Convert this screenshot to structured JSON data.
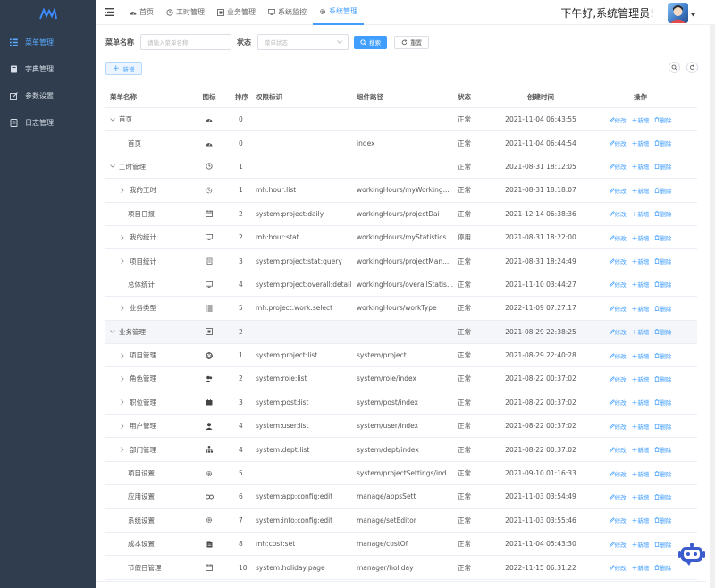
{
  "sidebar": {
    "logo_icon": "cat-logo-icon",
    "items": [
      {
        "label": "菜单管理",
        "icon": "menu-list-icon",
        "active": true
      },
      {
        "label": "字典管理",
        "icon": "book-icon",
        "active": false
      },
      {
        "label": "参数设置",
        "icon": "edit-icon",
        "active": false
      },
      {
        "label": "日志管理",
        "icon": "log-icon",
        "active": false,
        "has_children": true
      }
    ]
  },
  "header": {
    "tabs": [
      {
        "label": "首页",
        "icon": "dashboard-icon",
        "active": false
      },
      {
        "label": "工时管理",
        "icon": "clock-icon",
        "active": false
      },
      {
        "label": "业务管理",
        "icon": "business-icon",
        "active": false
      },
      {
        "label": "系统监控",
        "icon": "monitor-icon",
        "active": false
      },
      {
        "label": "系统管理",
        "icon": "gear-icon",
        "active": true
      }
    ],
    "greeting": "下午好,系统管理员!"
  },
  "search": {
    "menu_name_label": "菜单名称",
    "menu_name_placeholder": "请输入菜单名称",
    "status_label": "状态",
    "status_placeholder": "菜单状态",
    "search_button": "搜索",
    "reset_button": "重置"
  },
  "toolbar": {
    "add_button": "新增"
  },
  "table": {
    "columns": [
      "菜单名称",
      "图标",
      "排序",
      "权限标识",
      "组件路径",
      "状态",
      "创建时间",
      "操作"
    ],
    "ops": {
      "edit": "修改",
      "add": "新增",
      "delete": "删除"
    },
    "rows": [
      {
        "name": "首页",
        "level": 0,
        "expander": "down",
        "icon": "dashboard-icon",
        "sort": "0",
        "perm": "",
        "path": "",
        "status": "正常",
        "time": "2021-11-04 06:43:55"
      },
      {
        "name": "首页",
        "level": 1,
        "expander": "",
        "icon": "dashboard-icon",
        "sort": "0",
        "perm": "",
        "path": "index",
        "status": "正常",
        "time": "2021-11-04 06:44:54"
      },
      {
        "name": "工时管理",
        "level": 0,
        "expander": "down",
        "icon": "clock-icon",
        "sort": "1",
        "perm": "",
        "path": "",
        "status": "正常",
        "time": "2021-08-31 18:12:05"
      },
      {
        "name": "我的工时",
        "level": 1,
        "expander": "right",
        "icon": "time-record-icon",
        "sort": "1",
        "perm": "mh:hour:list",
        "path": "workingHours/myWorking...",
        "status": "正常",
        "time": "2021-08-31 18:18:07"
      },
      {
        "name": "项目日报",
        "level": 1,
        "expander": "",
        "icon": "calendar-icon",
        "sort": "2",
        "perm": "system:project:daily",
        "path": "workingHours/projectDai",
        "status": "正常",
        "time": "2021-12-14 06:38:36"
      },
      {
        "name": "我的统计",
        "level": 1,
        "expander": "right",
        "icon": "monitor-icon",
        "sort": "2",
        "perm": "mh:hour:stat",
        "path": "workingHours/myStatistics...",
        "status": "停用",
        "time": "2021-08-31 18:22:00"
      },
      {
        "name": "项目统计",
        "level": 1,
        "expander": "right",
        "icon": "clipboard-icon",
        "sort": "3",
        "perm": "system:project:stat:query",
        "path": "workingHours/projectMan...",
        "status": "正常",
        "time": "2021-08-31 18:24:49"
      },
      {
        "name": "总体统计",
        "level": 1,
        "expander": "",
        "icon": "monitor-icon",
        "sort": "4",
        "perm": "system:project:overall:detail",
        "path": "workingHours/overallStatis...",
        "status": "正常",
        "time": "2021-11-10 03:44:27"
      },
      {
        "name": "业务类型",
        "level": 1,
        "expander": "right",
        "icon": "list-icon",
        "sort": "5",
        "perm": "mh:project:work:select",
        "path": "workingHours/workType",
        "status": "正常",
        "time": "2022-11-09 07:27:17"
      },
      {
        "name": "业务管理",
        "level": 0,
        "expander": "down",
        "icon": "business-icon",
        "sort": "2",
        "perm": "",
        "path": "",
        "status": "正常",
        "time": "2021-08-29 22:38:25",
        "highlight": true
      },
      {
        "name": "项目管理",
        "level": 1,
        "expander": "right",
        "icon": "target-icon",
        "sort": "1",
        "perm": "system:project:list",
        "path": "system/project",
        "status": "正常",
        "time": "2021-08-29 22:40:28"
      },
      {
        "name": "角色管理",
        "level": 1,
        "expander": "right",
        "icon": "role-icon",
        "sort": "2",
        "perm": "system:role:list",
        "path": "system/role/index",
        "status": "正常",
        "time": "2021-08-22 00:37:02"
      },
      {
        "name": "职位管理",
        "level": 1,
        "expander": "right",
        "icon": "post-icon",
        "sort": "3",
        "perm": "system:post:list",
        "path": "system/post/index",
        "status": "正常",
        "time": "2021-08-22 00:37:02"
      },
      {
        "name": "用户管理",
        "level": 1,
        "expander": "right",
        "icon": "user-icon",
        "sort": "4",
        "perm": "system:user:list",
        "path": "system/user/index",
        "status": "正常",
        "time": "2021-08-22 00:37:02"
      },
      {
        "name": "部门管理",
        "level": 1,
        "expander": "right",
        "icon": "tree-icon",
        "sort": "4",
        "perm": "system:dept:list",
        "path": "system/dept/index",
        "status": "正常",
        "time": "2021-08-22 00:37:02"
      },
      {
        "name": "项目设置",
        "level": 1,
        "expander": "",
        "icon": "gear-icon",
        "sort": "5",
        "perm": "",
        "path": "system/projectSettings/ind...",
        "status": "正常",
        "time": "2021-09-10 01:16:33"
      },
      {
        "name": "应用设置",
        "level": 1,
        "expander": "",
        "icon": "link-icon",
        "sort": "6",
        "perm": "system:app:config:edit",
        "path": "manage/appsSett",
        "status": "正常",
        "time": "2021-11-03 03:54:49"
      },
      {
        "name": "系统设置",
        "level": 1,
        "expander": "",
        "icon": "gear-icon",
        "sort": "7",
        "perm": "system:info:config:edit",
        "path": "manage/setEditor",
        "status": "正常",
        "time": "2021-11-03 03:55:46"
      },
      {
        "name": "成本设置",
        "level": 1,
        "expander": "",
        "icon": "document-icon",
        "sort": "8",
        "perm": "mh:cost:set",
        "path": "manage/costOf",
        "status": "正常",
        "time": "2021-11-04 05:43:30"
      },
      {
        "name": "节假日管理",
        "level": 1,
        "expander": "",
        "icon": "calendar-icon",
        "sort": "10",
        "perm": "system:holiday:page",
        "path": "manager/holiday",
        "status": "正常",
        "time": "2022-11-15 06:31:22"
      }
    ]
  },
  "colors": {
    "primary": "#409eff",
    "sidebar_bg": "#2f3d4e",
    "sidebar_active": "#5aa9ff"
  }
}
